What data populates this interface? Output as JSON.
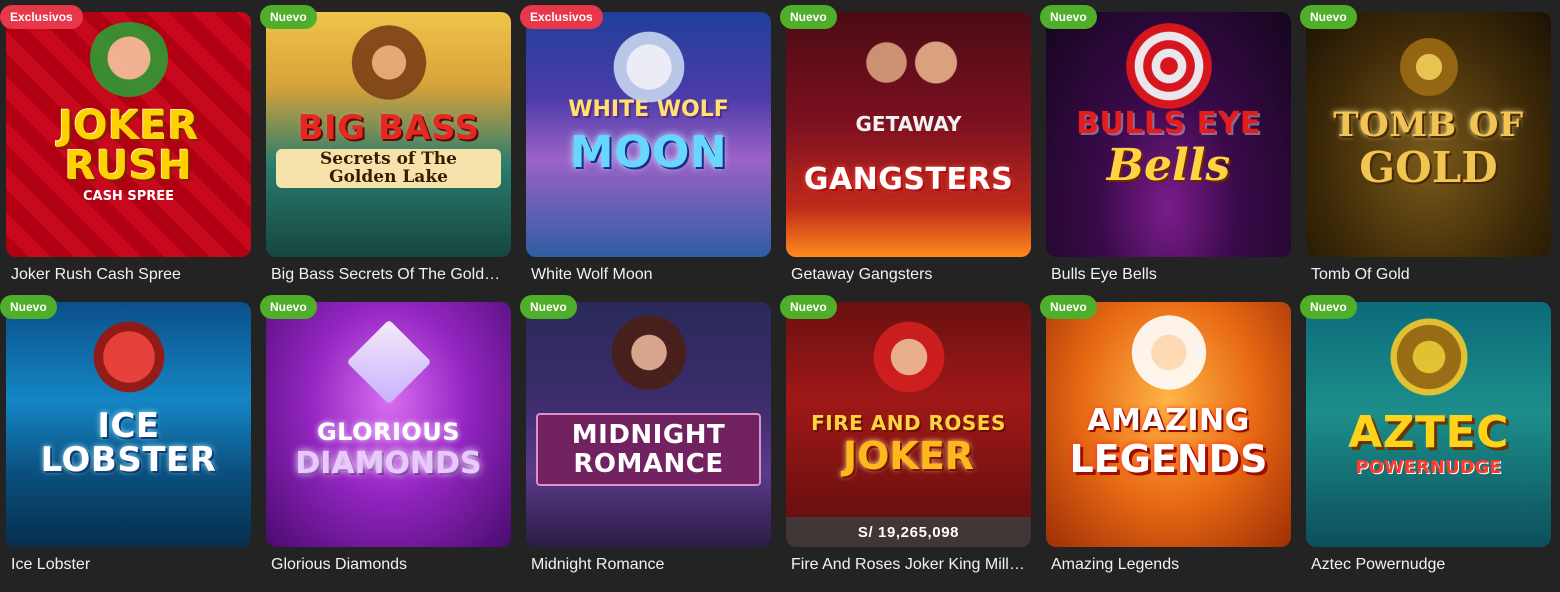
{
  "badges": {
    "exclusive": "Exclusivos",
    "new": "Nuevo"
  },
  "games": [
    {
      "title": "Joker Rush Cash Spree",
      "badge": "Exclusivos",
      "badge_type": "exclusive",
      "logo_main": "JOKER RUSH",
      "logo_sub": "CASH SPREE",
      "jackpot": ""
    },
    {
      "title": "Big Bass Secrets Of The Golden Lake",
      "badge": "Nuevo",
      "badge_type": "new",
      "logo_main": "BIG BASS",
      "logo_sub": "Secrets of The Golden Lake",
      "jackpot": ""
    },
    {
      "title": "White Wolf Moon",
      "badge": "Exclusivos",
      "badge_type": "exclusive",
      "logo_main": "MOON",
      "logo_sub": "WHITE WOLF",
      "jackpot": ""
    },
    {
      "title": "Getaway Gangsters",
      "badge": "Nuevo",
      "badge_type": "new",
      "logo_main": "GANGSTERS",
      "logo_sub": "GETAWAY",
      "jackpot": ""
    },
    {
      "title": "Bulls Eye Bells",
      "badge": "Nuevo",
      "badge_type": "new",
      "logo_main": "BULLS EYE",
      "logo_sub": "Bells",
      "jackpot": ""
    },
    {
      "title": "Tomb Of Gold",
      "badge": "Nuevo",
      "badge_type": "new",
      "logo_main": "TOMB OF",
      "logo_sub": "GOLD",
      "jackpot": ""
    },
    {
      "title": "Ice Lobster",
      "badge": "Nuevo",
      "badge_type": "new",
      "logo_main": "ICE LOBSTER",
      "logo_sub": "",
      "jackpot": ""
    },
    {
      "title": "Glorious Diamonds",
      "badge": "Nuevo",
      "badge_type": "new",
      "logo_main": "GLORIOUS",
      "logo_sub": "DIAMONDS",
      "jackpot": ""
    },
    {
      "title": "Midnight Romance",
      "badge": "Nuevo",
      "badge_type": "new",
      "logo_main": "MIDNIGHT ROMANCE",
      "logo_sub": "",
      "jackpot": ""
    },
    {
      "title": "Fire And Roses Joker King Millions",
      "badge": "Nuevo",
      "badge_type": "new",
      "logo_main": "FIRE AND ROSES",
      "logo_sub": "JOKER",
      "jackpot": "S/ 19,265,098"
    },
    {
      "title": "Amazing Legends",
      "badge": "Nuevo",
      "badge_type": "new",
      "logo_main": "AMAZING",
      "logo_sub": "LEGENDS",
      "jackpot": ""
    },
    {
      "title": "Aztec Powernudge",
      "badge": "Nuevo",
      "badge_type": "new",
      "logo_main": "AZTEC",
      "logo_sub": "POWERNUDGE",
      "jackpot": ""
    }
  ],
  "colors": {
    "background": "#232323",
    "badge_exclusive": "#e8374a",
    "badge_new": "#4fae2a",
    "title_text": "#f2f2f2"
  }
}
